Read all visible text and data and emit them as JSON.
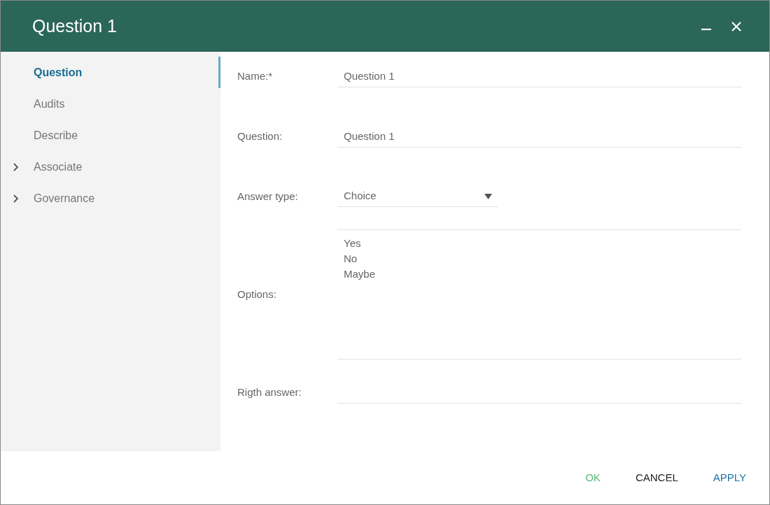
{
  "window": {
    "title": "Question 1",
    "controls": [
      {
        "kind": "minimize"
      },
      {
        "kind": "close"
      }
    ]
  },
  "sidebar": {
    "items": [
      {
        "label": "Question",
        "selected": true
      },
      {
        "label": "Audits",
        "selected": false
      },
      {
        "label": "Describe",
        "selected": false
      },
      {
        "label": "Associate",
        "selected": false,
        "expanded": false
      },
      {
        "label": "Governance",
        "selected": false,
        "expanded": false
      }
    ]
  },
  "form": {
    "fields": [
      {
        "kind": "text",
        "label": "Name:*",
        "value": "Question 1"
      },
      {
        "kind": "text",
        "label": "Question:",
        "value": "Question 1"
      },
      {
        "kind": "select",
        "label": "Answer type:",
        "value": "Choice"
      },
      {
        "kind": "textarea",
        "label": "Options:",
        "lines": [
          "Yes",
          "No",
          "Maybe"
        ]
      },
      {
        "kind": "text",
        "label": "Rigth answer:"
      }
    ]
  },
  "buttons": [
    {
      "label": "OK",
      "color": "#5cb87a"
    },
    {
      "label": "CANCEL",
      "color": "#222222"
    },
    {
      "label": "APPLY",
      "color": "#1a73a0"
    }
  ]
}
